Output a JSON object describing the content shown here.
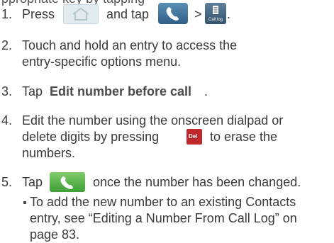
{
  "top_cut_text": "ppropriate key by tapping",
  "steps": [
    {
      "number": "1.",
      "parts": [
        "Press",
        "and tap",
        ">",
        "."
      ],
      "icons": [
        "home-icon",
        "phone-icon",
        "call-log-icon"
      ],
      "call_log_label": "Call log"
    },
    {
      "number": "2.",
      "lines": [
        "Touch and hold an entry to access the",
        "entry-specific options menu."
      ]
    },
    {
      "number": "3.",
      "prefix": "Tap",
      "bold": "Edit number before call",
      "suffix": "."
    },
    {
      "number": "4.",
      "lines": [
        "Edit the number using the onscreen dialpad or",
        "delete digits by pressing",
        "to erase the",
        "numbers."
      ],
      "del_label": "Del",
      "icon": "del-icon"
    },
    {
      "number": "5.",
      "prefix": "Tap",
      "suffix": "once the number has been changed.",
      "icon": "green-call-icon"
    }
  ],
  "sub_bullet": {
    "lines": [
      "To add the new number to an existing Contacts",
      "entry, see “Editing a Number From Call Log” on",
      "page 83."
    ]
  },
  "colors": {
    "text": "#3a3a3a",
    "home_icon_bg": "#e2ecf0",
    "phone_icon_blue": "#2e5f86",
    "del_red": "#c0272d",
    "call_green": "#3e9f36"
  }
}
